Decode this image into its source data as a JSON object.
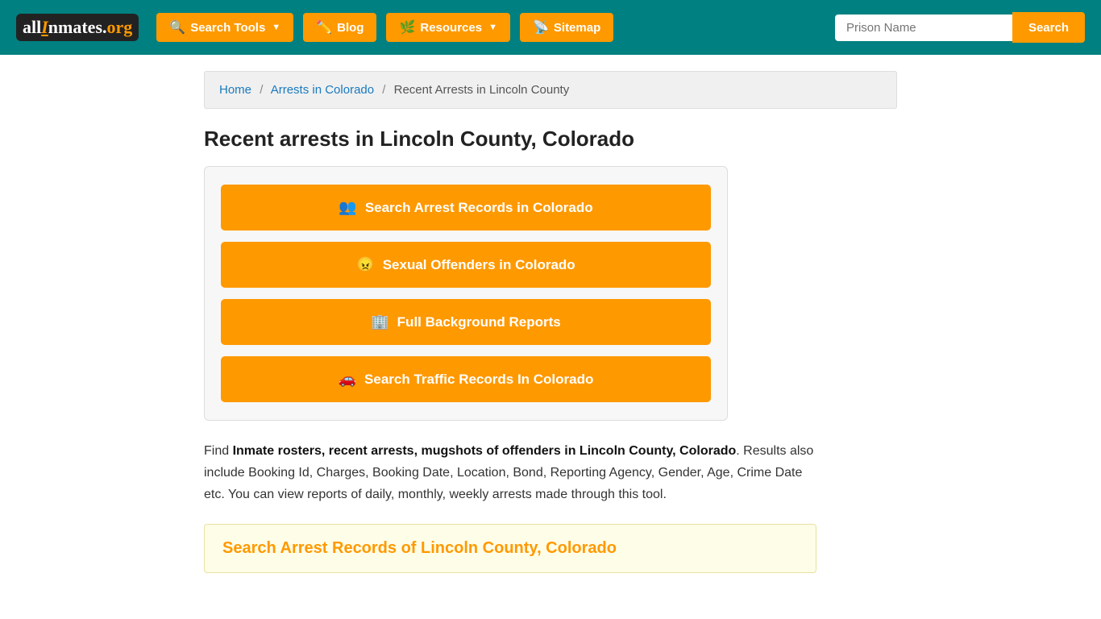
{
  "header": {
    "logo": {
      "part1": "all",
      "part2": "I",
      "part3": "nmates.",
      "part4": "org"
    },
    "nav": [
      {
        "id": "search-tools",
        "label": "Search Tools",
        "hasDropdown": true,
        "icon": "🔍"
      },
      {
        "id": "blog",
        "label": "Blog",
        "hasDropdown": false,
        "icon": "✏️"
      },
      {
        "id": "resources",
        "label": "Resources",
        "hasDropdown": true,
        "icon": "🌿"
      },
      {
        "id": "sitemap",
        "label": "Sitemap",
        "hasDropdown": false,
        "icon": "📡"
      }
    ],
    "search": {
      "placeholder": "Prison Name",
      "button_label": "Search"
    }
  },
  "breadcrumb": {
    "items": [
      {
        "label": "Home",
        "href": "#"
      },
      {
        "label": "Arrests in Colorado",
        "href": "#"
      },
      {
        "label": "Recent Arrests in Lincoln County",
        "href": "#",
        "current": true
      }
    ]
  },
  "page": {
    "title": "Recent arrests in Lincoln County, Colorado",
    "buttons": [
      {
        "id": "btn-arrest",
        "label": "Search Arrest Records in Colorado",
        "icon": "👥"
      },
      {
        "id": "btn-sexual",
        "label": "Sexual Offenders in Colorado",
        "icon": "😠"
      },
      {
        "id": "btn-background",
        "label": "Full Background Reports",
        "icon": "🏢"
      },
      {
        "id": "btn-traffic",
        "label": "Search Traffic Records In Colorado",
        "icon": "🚗"
      }
    ],
    "description_intro": "Find ",
    "description_bold": "Inmate rosters, recent arrests, mugshots of offenders in Lincoln County, Colorado",
    "description_rest": ". Results also include Booking Id, Charges, Booking Date, Location, Bond, Reporting Agency, Gender, Age, Crime Date etc. You can view reports of daily, monthly, weekly arrests made through this tool.",
    "section_title": "Search Arrest Records of Lincoln County, Colorado"
  }
}
